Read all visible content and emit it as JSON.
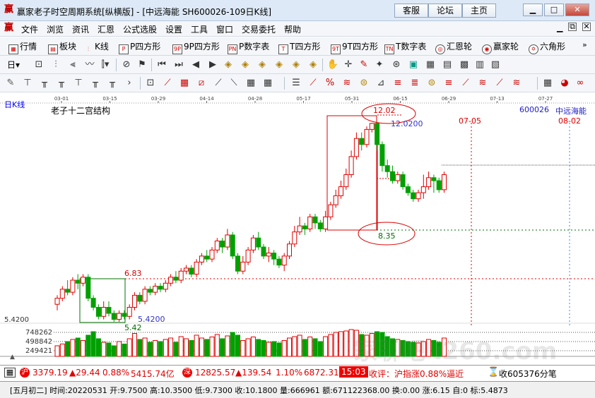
{
  "window": {
    "app_icon": "赢",
    "title": "赢家老子时空周期系统[纵横版] - [中远海能  SH600026-109日K线]",
    "buttons": [
      "客服",
      "论坛",
      "主页"
    ]
  },
  "menu": [
    "文件",
    "浏览",
    "资讯",
    "汇恩",
    "公式选股",
    "设置",
    "工具",
    "窗口",
    "交易委托",
    "帮助"
  ],
  "toolbar1": [
    {
      "icon": "grid-icon",
      "label": "行情"
    },
    {
      "icon": "blocks-icon",
      "label": "板块"
    },
    {
      "icon": "candlestick-icon",
      "label": "K线"
    },
    {
      "icon": "P",
      "label": "P四方形"
    },
    {
      "icon": "9P",
      "label": "9P四方形"
    },
    {
      "icon": "PN",
      "label": "P数字表"
    },
    {
      "icon": "T",
      "label": "T四方形"
    },
    {
      "icon": "9T",
      "label": "9T四方形"
    },
    {
      "icon": "TN",
      "label": "T数字表"
    },
    {
      "icon": "wheel-icon",
      "label": "汇恩轮"
    },
    {
      "icon": "wheel2-icon",
      "label": "赢家轮"
    },
    {
      "icon": "hexagram-icon",
      "label": "六角形"
    }
  ],
  "chart": {
    "period_label": "日K线",
    "indicator_name": "老子十二宫结构",
    "stock_code": "600026",
    "stock_name": "中远海能",
    "dates": [
      "03-01",
      "03-15",
      "03-29",
      "04-14",
      "04-28",
      "05-17",
      "05-31",
      "06-15",
      "06-29",
      "07-13",
      "07-27"
    ],
    "markers": {
      "high": "12.02",
      "high_value": "12.0200",
      "low_box": "8.35",
      "level_683": "6.83",
      "level_542": "5.42",
      "level_542b": "5.4200",
      "cycle_date1": "07-05",
      "cycle_date2": "08-02"
    },
    "volume_ticks": [
      "748262",
      "498842",
      "249421"
    ],
    "price_left_tick": "5.4200",
    "watermark": "家聊吧  i260.com"
  },
  "chart_data": {
    "type": "candlestick",
    "y_range": [
      5.3,
      12.6
    ],
    "candles": [
      [
        6.0,
        6.2,
        5.8,
        6.3
      ],
      [
        6.2,
        6.5,
        6.1,
        6.6
      ],
      [
        6.5,
        6.4,
        6.3,
        6.8
      ],
      [
        6.4,
        6.8,
        6.3,
        6.9
      ],
      [
        6.8,
        6.7,
        6.5,
        7.0
      ],
      [
        6.7,
        6.9,
        6.6,
        7.0
      ],
      [
        6.9,
        6.2,
        6.1,
        7.0
      ],
      [
        6.2,
        5.9,
        5.8,
        6.3
      ],
      [
        5.9,
        5.6,
        5.5,
        6.0
      ],
      [
        5.6,
        5.9,
        5.5,
        6.1
      ],
      [
        5.9,
        5.7,
        5.6,
        6.1
      ],
      [
        5.7,
        5.5,
        5.42,
        5.8
      ],
      [
        5.5,
        5.7,
        5.42,
        5.8
      ],
      [
        5.7,
        5.6,
        5.5,
        5.8
      ],
      [
        5.6,
        5.9,
        5.5,
        6.0
      ],
      [
        5.9,
        6.3,
        5.8,
        6.4
      ],
      [
        6.3,
        6.1,
        6.0,
        6.4
      ],
      [
        6.1,
        6.5,
        6.0,
        6.6
      ],
      [
        6.5,
        6.4,
        6.3,
        6.6
      ],
      [
        6.4,
        6.6,
        6.3,
        6.7
      ],
      [
        6.6,
        6.5,
        6.4,
        6.7
      ],
      [
        6.5,
        6.7,
        6.4,
        6.8
      ],
      [
        6.7,
        6.9,
        6.6,
        7.0
      ],
      [
        6.9,
        6.8,
        6.7,
        7.1
      ],
      [
        6.8,
        7.1,
        6.7,
        7.2
      ],
      [
        7.1,
        7.2,
        7.0,
        7.3
      ],
      [
        7.2,
        7.0,
        6.9,
        7.3
      ],
      [
        7.0,
        7.4,
        6.9,
        7.5
      ],
      [
        7.4,
        7.6,
        7.3,
        7.7
      ],
      [
        7.6,
        7.5,
        7.4,
        7.8
      ],
      [
        7.5,
        7.8,
        7.4,
        7.9
      ],
      [
        7.8,
        8.1,
        7.7,
        8.2
      ],
      [
        8.1,
        7.9,
        7.7,
        8.2
      ],
      [
        7.9,
        8.3,
        7.8,
        8.5
      ],
      [
        8.3,
        7.6,
        7.5,
        8.4
      ],
      [
        7.6,
        7.1,
        7.0,
        7.7
      ],
      [
        7.1,
        7.4,
        7.0,
        7.6
      ],
      [
        7.4,
        7.8,
        7.3,
        7.9
      ],
      [
        7.8,
        8.2,
        7.7,
        8.3
      ],
      [
        8.2,
        7.9,
        7.8,
        8.4
      ],
      [
        7.9,
        7.6,
        7.5,
        8.0
      ],
      [
        7.6,
        7.7,
        7.4,
        7.9
      ],
      [
        7.7,
        7.5,
        7.3,
        7.8
      ],
      [
        7.5,
        7.3,
        7.2,
        7.6
      ],
      [
        7.3,
        7.6,
        7.1,
        7.7
      ],
      [
        7.6,
        8.0,
        7.5,
        8.1
      ],
      [
        8.0,
        8.4,
        7.9,
        8.6
      ],
      [
        8.4,
        8.6,
        8.3,
        8.9
      ],
      [
        8.6,
        8.5,
        8.3,
        8.7
      ],
      [
        8.5,
        8.9,
        8.4,
        9.0
      ],
      [
        8.9,
        8.7,
        8.5,
        9.0
      ],
      [
        8.7,
        8.5,
        8.4,
        8.8
      ],
      [
        8.5,
        8.9,
        8.4,
        9.1
      ],
      [
        8.9,
        9.3,
        8.8,
        9.4
      ],
      [
        9.3,
        9.6,
        9.2,
        9.8
      ],
      [
        9.6,
        9.9,
        9.5,
        10.1
      ],
      [
        9.9,
        10.3,
        9.8,
        10.5
      ],
      [
        10.3,
        10.9,
        10.2,
        11.1
      ],
      [
        10.9,
        11.5,
        10.8,
        11.7
      ],
      [
        11.5,
        11.3,
        11.1,
        11.7
      ],
      [
        11.3,
        11.8,
        11.2,
        11.9
      ],
      [
        11.8,
        12.0,
        11.7,
        12.02
      ],
      [
        12.0,
        11.3,
        11.1,
        12.02
      ],
      [
        11.3,
        10.6,
        10.4,
        11.4
      ],
      [
        10.6,
        10.4,
        10.2,
        10.8
      ],
      [
        10.4,
        10.1,
        10.0,
        10.6
      ],
      [
        10.1,
        10.3,
        10.0,
        10.4
      ],
      [
        10.3,
        9.9,
        9.8,
        10.4
      ],
      [
        9.9,
        9.7,
        9.6,
        10.0
      ],
      [
        9.7,
        9.5,
        9.4,
        9.8
      ],
      [
        9.5,
        9.7,
        9.4,
        9.8
      ],
      [
        9.7,
        9.9,
        9.5,
        10.3
      ],
      [
        9.9,
        10.2,
        9.8,
        10.4
      ],
      [
        10.2,
        10.1,
        9.7,
        10.3
      ],
      [
        10.1,
        9.8,
        9.7,
        10.2
      ],
      [
        9.8,
        10.3,
        9.7,
        10.4
      ]
    ],
    "volume": [
      300000,
      350000,
      420000,
      480000,
      520000,
      450000,
      600000,
      700000,
      500000,
      400000,
      380000,
      300000,
      420000,
      350000,
      500000,
      650000,
      480000,
      520000,
      400000,
      450000,
      420000,
      480000,
      520000,
      400000,
      560000,
      500000,
      450000,
      600000,
      520000,
      480000,
      550000,
      620000,
      500000,
      580000,
      680000,
      600000,
      450000,
      500000,
      550000,
      480000,
      450000,
      400000,
      420000,
      380000,
      450000,
      520000,
      560000,
      600000,
      480000,
      550000,
      500000,
      420000,
      560000,
      620000,
      680000,
      700000,
      720000,
      760000,
      740000,
      620000,
      600000,
      650000,
      700000,
      680000,
      560000,
      500000,
      480000,
      450000,
      420000,
      400000,
      380000,
      420000,
      480000,
      450000,
      400000,
      520000
    ]
  },
  "status1": {
    "sh_label": "沪",
    "sh_index": "3379.19",
    "sh_change": "▲29.44",
    "sh_pct": "0.88%",
    "sh_amount": "5415.74亿",
    "sz_label": "深",
    "sz_index": "12825.57",
    "sz_change": "▲139.54",
    "sz_pct": "1.10%",
    "sz_amount": "6872.31",
    "time": "15:03",
    "comment": "收评：沪指涨0.88%逼近",
    "ticker": "收605376分笔"
  },
  "status2": {
    "text": "[五月初二] 时间:20220531 开:9.7500 高:10.3500 低:9.7300 收:10.1800 量:666961 额:671122368.00 换:0.00 涨:6.15 自:0 标:5.4873"
  }
}
